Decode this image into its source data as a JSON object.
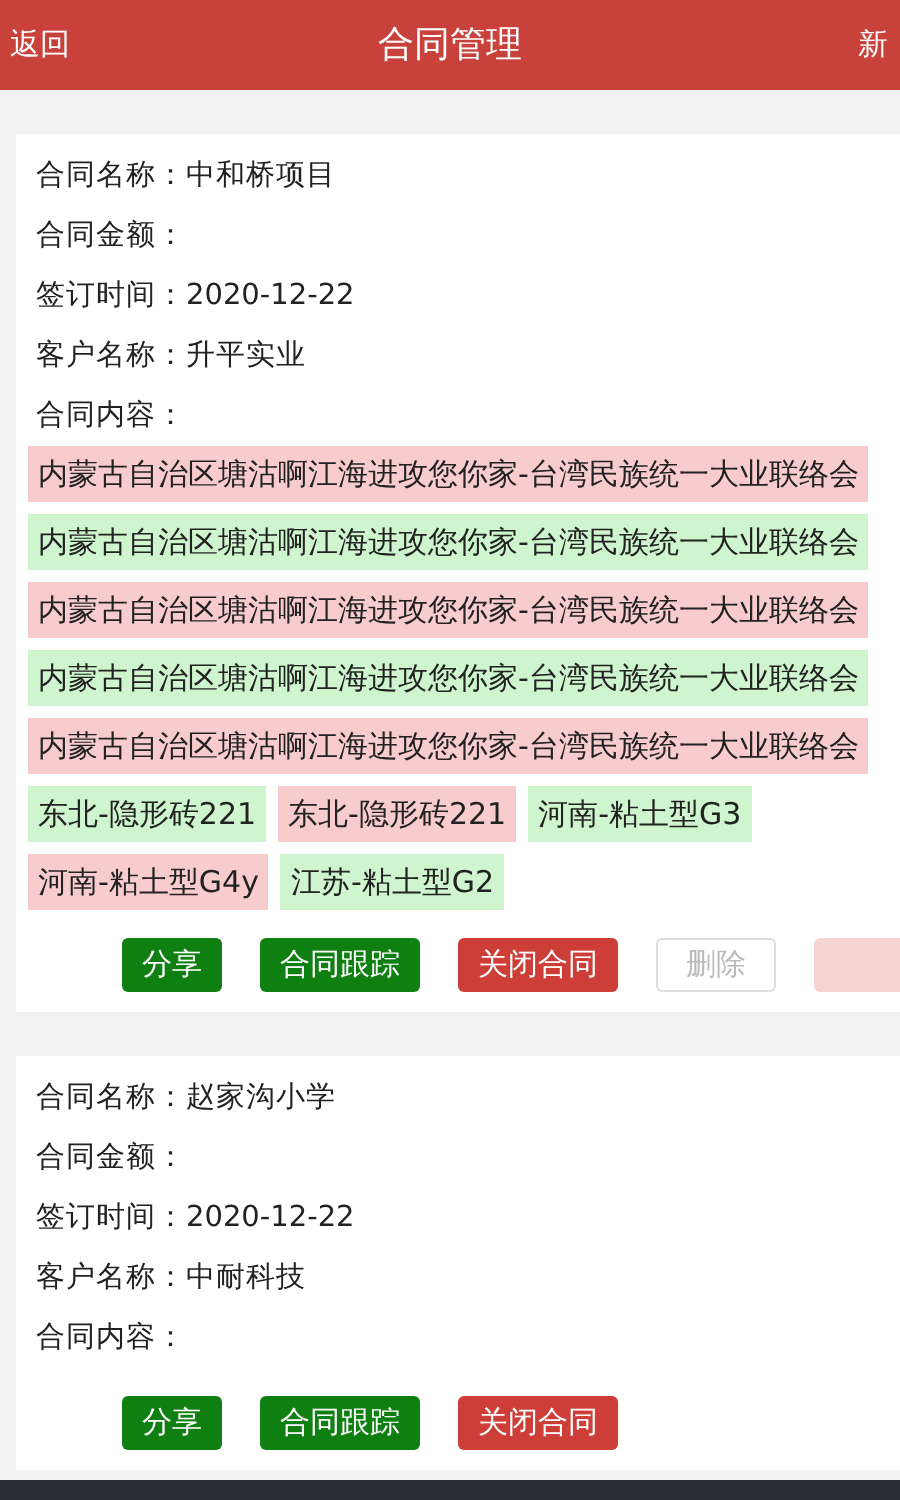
{
  "header": {
    "back": "返回",
    "title": "合同管理",
    "add": "新"
  },
  "contracts": [
    {
      "fields": [
        {
          "label": "合同名称：",
          "value": "中和桥项目"
        },
        {
          "label": "合同金额："
        },
        {
          "label": "签订时间：",
          "value": "2020-12-22"
        },
        {
          "label": "客户名称：",
          "value": "升平实业"
        },
        {
          "label": "合同内容："
        }
      ],
      "tags": [
        {
          "text": "内蒙古自治区塘沽啊江海进攻您你家-台湾民族统一大业联络会",
          "color": "#f8cccc"
        },
        {
          "text": "内蒙古自治区塘沽啊江海进攻您你家-台湾民族统一大业联络会",
          "color": "#cef5ce"
        },
        {
          "text": "内蒙古自治区塘沽啊江海进攻您你家-台湾民族统一大业联络会",
          "color": "#f8cccc"
        },
        {
          "text": "内蒙古自治区塘沽啊江海进攻您你家-台湾民族统一大业联络会",
          "color": "#cef5ce"
        },
        {
          "text": "内蒙古自治区塘沽啊江海进攻您你家-台湾民族统一大业联络会",
          "color": "#f8cccc"
        },
        {
          "text": "东北-隐形砖221",
          "color": "#cef5ce"
        },
        {
          "text": "东北-隐形砖221",
          "color": "#f8cccc"
        },
        {
          "text": "河南-粘土型G3",
          "color": "#cef5ce"
        },
        {
          "text": "河南-粘土型G4y",
          "color": "#f8cccc"
        },
        {
          "text": "江苏-粘土型G2",
          "color": "#cef5ce"
        }
      ],
      "buttons": [
        {
          "label": "分享",
          "kind": "success",
          "disabled": false
        },
        {
          "label": "合同跟踪",
          "kind": "success",
          "disabled": false
        },
        {
          "label": "关闭合同",
          "kind": "danger",
          "disabled": false
        },
        {
          "label": "删除",
          "kind": "default",
          "disabled": true
        },
        {
          "kind": "danger",
          "disabled": true
        }
      ]
    },
    {
      "fields": [
        {
          "label": "合同名称：",
          "value": "赵家沟小学"
        },
        {
          "label": "合同金额："
        },
        {
          "label": "签订时间：",
          "value": "2020-12-22"
        },
        {
          "label": "客户名称：",
          "value": "中耐科技"
        },
        {
          "label": "合同内容："
        }
      ],
      "buttons": [
        {
          "label": "分享",
          "kind": "success",
          "disabled": false
        },
        {
          "label": "合同跟踪",
          "kind": "success",
          "disabled": false
        },
        {
          "label": "关闭合同",
          "kind": "danger",
          "disabled": false
        }
      ]
    }
  ]
}
